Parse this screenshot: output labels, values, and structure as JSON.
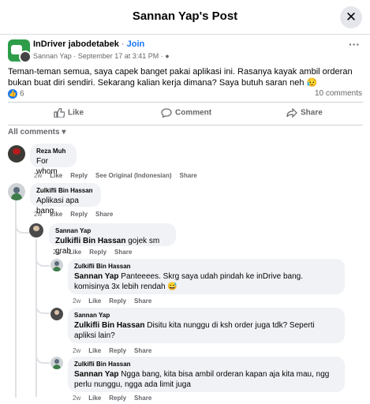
{
  "header": {
    "title": "Sannan Yap's Post",
    "close_glyph": "✕"
  },
  "post": {
    "group_name": "InDriver jabodetabek",
    "separator": " · ",
    "join_label": "Join",
    "author": "Sannan Yap",
    "time": "September 17 at 3:41 PM",
    "more_glyph": "···",
    "text": "Teman-teman semua, saya capek banget pakai aplikasi ini. Rasanya kayak ambil orderan bukan buat diri sendiri. Sekarang kalian kerja dimana? Saya butuh saran neh 😥",
    "reaction_count": "6",
    "comments_count": "10 comments"
  },
  "actions": {
    "like": "Like",
    "comment": "Comment",
    "share": "Share"
  },
  "comments_filter": "All comments ▾",
  "comments": [
    {
      "author": "Reza Muh",
      "tag": "",
      "text": "For whom",
      "time": "2w",
      "links": [
        "Like",
        "Reply",
        "See Original (Indonesian)",
        "Share"
      ]
    },
    {
      "author": "Zulkifli Bin Hassan",
      "tag": "",
      "text": "Aplikasi apa bang",
      "time": "2w",
      "links": [
        "Like",
        "Reply",
        "Share"
      ]
    },
    {
      "author": "Sannan Yap",
      "tag": "Zulkifli Bin Hassan",
      "text": "gojek sm grab",
      "time": "2w",
      "links": [
        "Like",
        "Reply",
        "Share"
      ]
    },
    {
      "author": "Zulkifli Bin Hassan",
      "tag": "Sannan Yap",
      "text": "Panteeees. Skrg saya udah pindah ke inDrive bang. komisinya 3x lebih rendah 😅",
      "time": "2w",
      "links": [
        "Like",
        "Reply",
        "Share"
      ]
    },
    {
      "author": "Sannan Yap",
      "tag": "Zulkifli Bin Hassan",
      "text": "Disitu kita nunggu di ksh order juga tdk? Seperti apliksi lain?",
      "time": "2w",
      "links": [
        "Like",
        "Reply",
        "Share"
      ]
    },
    {
      "author": "Zulkifli Bin Hassan",
      "tag": "Sannan Yap",
      "text": "Ngga bang, kita bisa ambil orderan kapan aja kita mau, ngg perlu nunggu, ngga ada limit juga",
      "time": "2w",
      "links": [
        "Like",
        "Reply",
        "Share"
      ]
    }
  ],
  "colors": {
    "brand": "#1877f2",
    "group_avatar": "#2e9d4a",
    "bubble": "#f0f2f5"
  }
}
